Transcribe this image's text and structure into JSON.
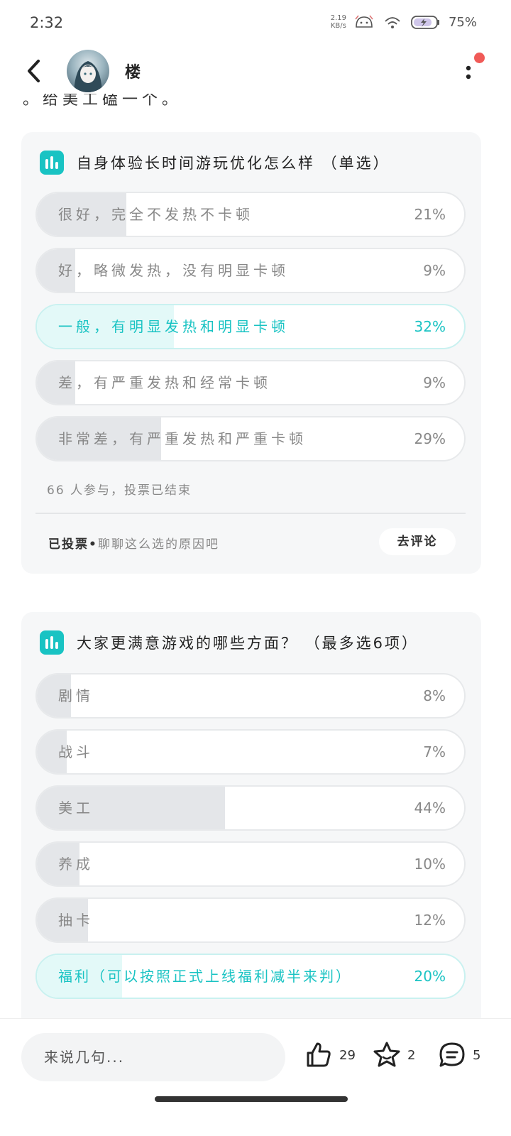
{
  "status": {
    "time": "2:32",
    "net_speed_value": "2.19",
    "net_speed_unit": "KB/s",
    "battery": "75%"
  },
  "header": {
    "author": "楼"
  },
  "clipped_text": "。给美工磕一个。",
  "poll1": {
    "title": "自身体验长时间游玩优化怎么样 （单选）",
    "options": [
      {
        "label": "很好，完全不发热不卡顿",
        "percent": "21%",
        "fraction": 0.21
      },
      {
        "label": "好，略微发热，没有明显卡顿",
        "percent": "9%",
        "fraction": 0.09
      },
      {
        "label": "一般，有明显发热和明显卡顿",
        "percent": "32%",
        "fraction": 0.32,
        "selected": true
      },
      {
        "label": "差，有严重发热和经常卡顿",
        "percent": "9%",
        "fraction": 0.09
      },
      {
        "label": "非常差，有严重发热和严重卡顿",
        "percent": "29%",
        "fraction": 0.29
      }
    ],
    "meta": "66 人参与，投票已结束",
    "voted_label": "已投票•",
    "voted_hint": "聊聊这么选的原因吧",
    "comment_button": "去评论"
  },
  "poll2": {
    "title": "大家更满意游戏的哪些方面？ （最多选6项）",
    "options": [
      {
        "label": "剧情",
        "percent": "8%",
        "fraction": 0.08
      },
      {
        "label": "战斗",
        "percent": "7%",
        "fraction": 0.07
      },
      {
        "label": "美工",
        "percent": "44%",
        "fraction": 0.44
      },
      {
        "label": "养成",
        "percent": "10%",
        "fraction": 0.1
      },
      {
        "label": "抽卡",
        "percent": "12%",
        "fraction": 0.12
      },
      {
        "label": "福利（可以按照正式上线福利减半来判）",
        "percent": "20%",
        "fraction": 0.2,
        "selected": true
      }
    ]
  },
  "bottom": {
    "input_placeholder": "来说几句...",
    "likes": "29",
    "favorites": "2",
    "comments": "5"
  },
  "colors": {
    "accent": "#19c3c3",
    "selected_fill": "#e3f9f8",
    "bar_fill": "#e4e6e9",
    "notification_dot": "#f05a57"
  },
  "icons": [
    "back-icon",
    "more-icon",
    "poll-icon",
    "thumbs-up-icon",
    "star-icon",
    "comment-icon"
  ]
}
